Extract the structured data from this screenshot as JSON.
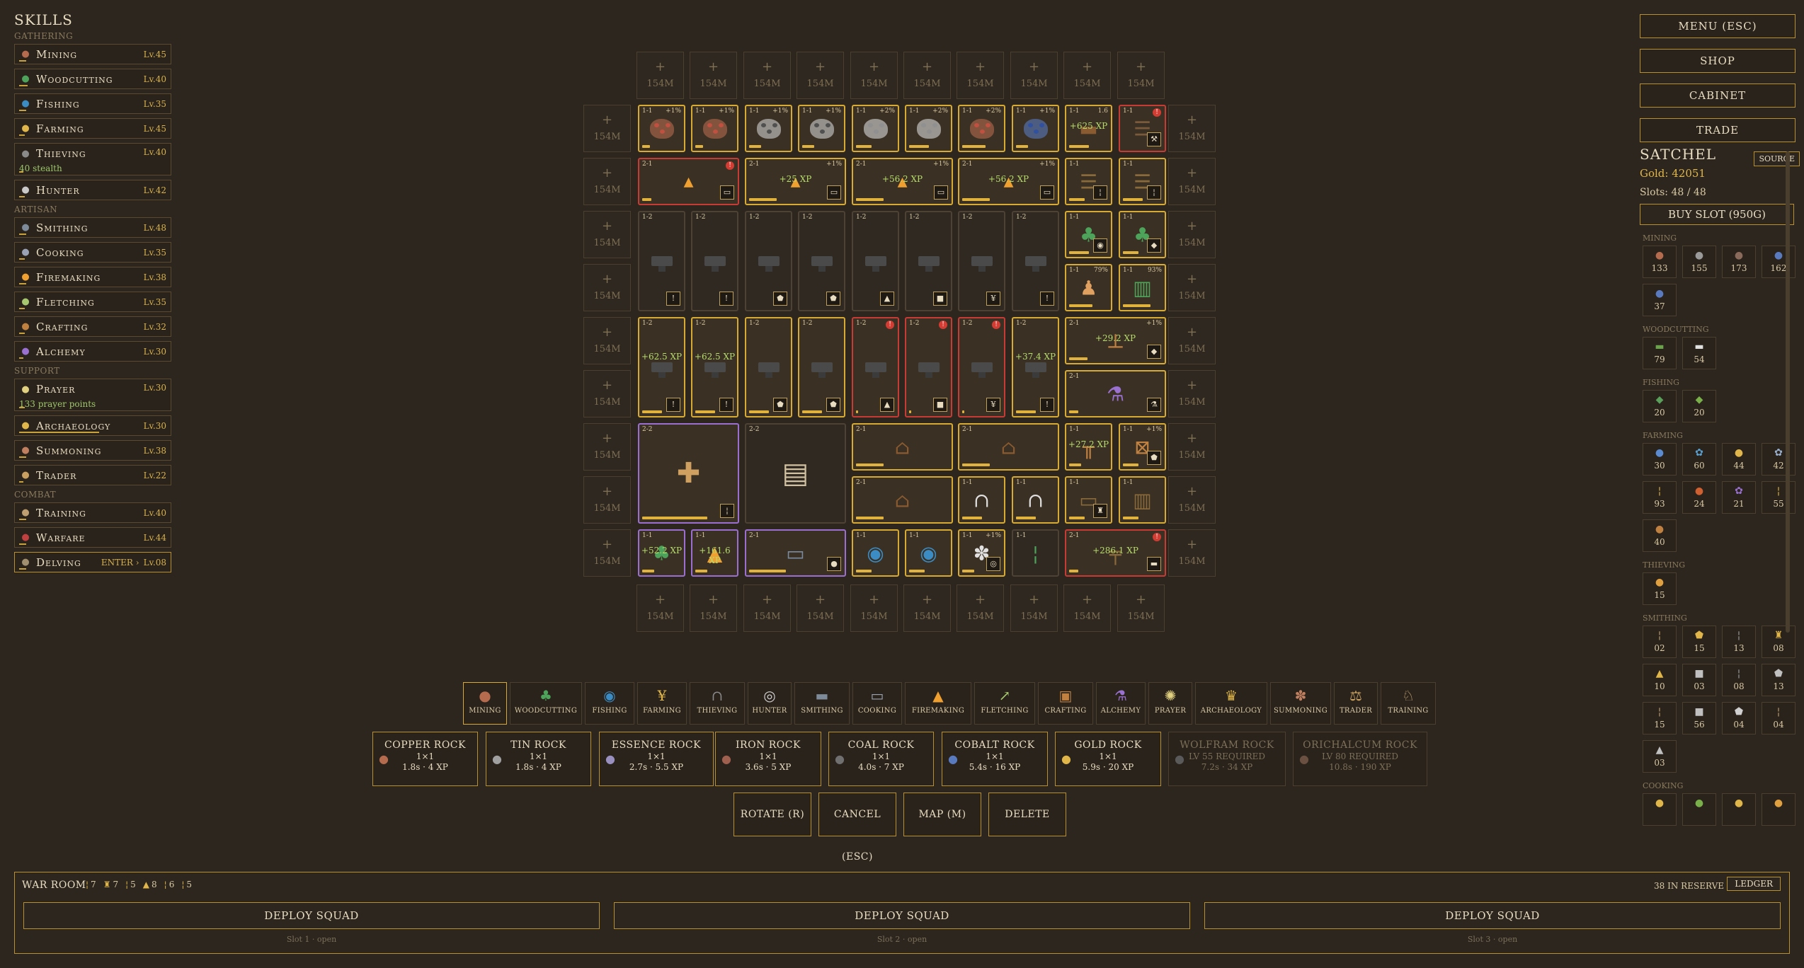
{
  "skills_panel": {
    "title": "SKILLS",
    "categories": [
      {
        "name": "GATHERING",
        "skills": [
          {
            "name": "Mining",
            "level": "Lv.45",
            "icon": "ore-icon",
            "color": "#b46b4e",
            "progress": 0.05
          },
          {
            "name": "Woodcutting",
            "level": "Lv.40",
            "icon": "tree-icon",
            "color": "#4da35a",
            "progress": 0.06
          },
          {
            "name": "Fishing",
            "level": "Lv.35",
            "icon": "fish-icon",
            "color": "#3b8cc4",
            "progress": 0.05
          },
          {
            "name": "Farming",
            "level": "Lv.45",
            "icon": "wheat-icon",
            "color": "#e0b64a",
            "progress": 0.04
          },
          {
            "name": "Thieving",
            "level": "Lv.40",
            "icon": "hood-icon",
            "color": "#8a8a8a",
            "progress": 0.03,
            "sub": "40 stealth"
          },
          {
            "name": "Hunter",
            "level": "Lv.42",
            "icon": "trap-icon",
            "color": "#c9c9c9",
            "progress": 0.04
          }
        ]
      },
      {
        "name": "ARTISAN",
        "skills": [
          {
            "name": "Smithing",
            "level": "Lv.48",
            "icon": "anvil-icon",
            "color": "#7d8a9a",
            "progress": 0.05
          },
          {
            "name": "Cooking",
            "level": "Lv.35",
            "icon": "pot-icon",
            "color": "#9aa3b5",
            "progress": 0.04
          },
          {
            "name": "Firemaking",
            "level": "Lv.38",
            "icon": "fire-icon",
            "color": "#f0a030",
            "progress": 0.05
          },
          {
            "name": "Fletching",
            "level": "Lv.35",
            "icon": "arrow-icon",
            "color": "#a8c870",
            "progress": 0.04
          },
          {
            "name": "Crafting",
            "level": "Lv.32",
            "icon": "frame-icon",
            "color": "#c08040",
            "progress": 0.04
          },
          {
            "name": "Alchemy",
            "level": "Lv.30",
            "icon": "flask-icon",
            "color": "#9a70d0",
            "progress": 0.03
          }
        ]
      },
      {
        "name": "SUPPORT",
        "skills": [
          {
            "name": "Prayer",
            "level": "Lv.30",
            "icon": "halo-icon",
            "color": "#e0d080",
            "progress": 0.04,
            "sub": "133 prayer points"
          },
          {
            "name": "Archaeology",
            "level": "Lv.30",
            "icon": "idol-icon",
            "color": "#e0b64a",
            "progress": 0.55
          },
          {
            "name": "Summoning",
            "level": "Lv.38",
            "icon": "paw-icon",
            "color": "#c08060",
            "progress": 0.05
          },
          {
            "name": "Trader",
            "level": "Lv.22",
            "icon": "scales-icon",
            "color": "#c9a060",
            "progress": 0.03
          }
        ]
      },
      {
        "name": "COMBAT",
        "skills": [
          {
            "name": "Training",
            "level": "Lv.40",
            "icon": "horn-icon",
            "color": "#c0a070",
            "progress": 0.05
          },
          {
            "name": "Warfare",
            "level": "Lv.44",
            "icon": "flag-icon",
            "color": "#c04040",
            "progress": 0.05
          },
          {
            "name": "Delving",
            "level": "Lv.08",
            "icon": "arch-icon",
            "color": "#a09070",
            "progress": 0.05,
            "enter": "ENTER ›",
            "active": true
          }
        ]
      }
    ]
  },
  "grid": {
    "expand_cost": "154M",
    "xp_popups": [
      "+62.5 XP",
      "+62.5 XP",
      "+56.2 XP",
      "+56.2 XP",
      "+37.4 XP",
      "+27.2 XP",
      "+29.2 XP",
      "+161.6 XP",
      "+286.1 XP",
      "+25 XP",
      "+625 XP",
      "+52.2 XP"
    ],
    "tile_labels": [
      "1-1",
      "2-1",
      "1-2",
      "2-2",
      "+1%",
      "+2%",
      "+1%",
      "79%",
      "93%"
    ]
  },
  "right_panel": {
    "buttons": [
      "MENU (ESC)",
      "SHOP",
      "CABINET",
      "TRADE"
    ],
    "satchel": {
      "title": "SATCHEL",
      "source_btn": "SOURCE",
      "gold": "Gold: 42051",
      "slots": "Slots: 48 / 48",
      "buy_slot": "BUY SLOT (950G)",
      "categories": [
        {
          "name": "MINING",
          "items": [
            {
              "i": "●",
              "c": "#b46b4e",
              "n": "133"
            },
            {
              "i": "●",
              "c": "#9a9a9a",
              "n": "155"
            },
            {
              "i": "●",
              "c": "#8a6a5a",
              "n": "173"
            },
            {
              "i": "●",
              "c": "#5a7ac0",
              "n": "162"
            },
            {
              "i": "●",
              "c": "#5a7ac0",
              "n": "37"
            }
          ]
        },
        {
          "name": "WOODCUTTING",
          "items": [
            {
              "i": "▬",
              "c": "#6aa34a",
              "n": "79"
            },
            {
              "i": "▬",
              "c": "#e0e0e0",
              "n": "54"
            }
          ]
        },
        {
          "name": "FISHING",
          "items": [
            {
              "i": "◆",
              "c": "#5aa05a",
              "n": "20"
            },
            {
              "i": "◆",
              "c": "#7ab04a",
              "n": "20"
            }
          ]
        },
        {
          "name": "FARMING",
          "items": [
            {
              "i": "●",
              "c": "#5a8ad0",
              "n": "30"
            },
            {
              "i": "✿",
              "c": "#5aa0d0",
              "n": "60"
            },
            {
              "i": "●",
              "c": "#e0b64a",
              "n": "44"
            },
            {
              "i": "✿",
              "c": "#9ab0d0",
              "n": "42"
            },
            {
              "i": "¦",
              "c": "#e0b64a",
              "n": "93"
            },
            {
              "i": "●",
              "c": "#d06030",
              "n": "24"
            },
            {
              "i": "✿",
              "c": "#9a70d0",
              "n": "21"
            },
            {
              "i": "¦",
              "c": "#e0b64a",
              "n": "55"
            },
            {
              "i": "●",
              "c": "#c08040",
              "n": "40"
            }
          ]
        },
        {
          "name": "THIEVING",
          "items": [
            {
              "i": "●",
              "c": "#e0a040",
              "n": "15"
            }
          ]
        },
        {
          "name": "SMITHING",
          "items": [
            {
              "i": "¦",
              "c": "#c0a070",
              "n": "02"
            },
            {
              "i": "⬟",
              "c": "#e0b64a",
              "n": "15"
            },
            {
              "i": "¦",
              "c": "#a0a0a0",
              "n": "13"
            },
            {
              "i": "♜",
              "c": "#e0b64a",
              "n": "08"
            },
            {
              "i": "▲",
              "c": "#e0b64a",
              "n": "10"
            },
            {
              "i": "■",
              "c": "#c0c0c0",
              "n": "03"
            },
            {
              "i": "¦",
              "c": "#a0a0a0",
              "n": "08"
            },
            {
              "i": "⬟",
              "c": "#c0c0c0",
              "n": "13"
            },
            {
              "i": "¦",
              "c": "#c0a070",
              "n": "15"
            },
            {
              "i": "■",
              "c": "#c0c0c0",
              "n": "56"
            },
            {
              "i": "⬟",
              "c": "#d0d0d0",
              "n": "04"
            },
            {
              "i": "¦",
              "c": "#c0a070",
              "n": "04"
            },
            {
              "i": "▲",
              "c": "#c0c0c0",
              "n": "03"
            }
          ]
        },
        {
          "name": "COOKING",
          "items": [
            {
              "i": "●",
              "c": "#e0b64a",
              "n": ""
            },
            {
              "i": "●",
              "c": "#7ab04a",
              "n": ""
            },
            {
              "i": "●",
              "c": "#e0b64a",
              "n": ""
            },
            {
              "i": "●",
              "c": "#e0a040",
              "n": ""
            }
          ]
        }
      ]
    }
  },
  "skill_tabs": [
    {
      "label": "MINING",
      "icon": "●",
      "color": "#b46b4e",
      "active": true
    },
    {
      "label": "WOODCUTTING",
      "icon": "♣",
      "color": "#4da35a"
    },
    {
      "label": "FISHING",
      "icon": "◉",
      "color": "#3b8cc4"
    },
    {
      "label": "FARMING",
      "icon": "¥",
      "color": "#e0b64a"
    },
    {
      "label": "THIEVING",
      "icon": "∩",
      "color": "#8a8a8a"
    },
    {
      "label": "HUNTER",
      "icon": "◎",
      "color": "#d0d0d0"
    },
    {
      "label": "SMITHING",
      "icon": "▬",
      "color": "#7d8a9a"
    },
    {
      "label": "COOKING",
      "icon": "▭",
      "color": "#9aa3b5"
    },
    {
      "label": "FIREMAKING",
      "icon": "▲",
      "color": "#f0a030"
    },
    {
      "label": "FLETCHING",
      "icon": "↗",
      "color": "#a8c870"
    },
    {
      "label": "CRAFTING",
      "icon": "▣",
      "color": "#c08040"
    },
    {
      "label": "ALCHEMY",
      "icon": "⚗",
      "color": "#9a70d0"
    },
    {
      "label": "PRAYER",
      "icon": "✺",
      "color": "#e0d080"
    },
    {
      "label": "ARCHAEOLOGY",
      "icon": "♛",
      "color": "#e0b64a"
    },
    {
      "label": "SUMMONING",
      "icon": "✽",
      "color": "#c08060"
    },
    {
      "label": "TRADER",
      "icon": "⚖",
      "color": "#c9a060"
    },
    {
      "label": "TRAINING",
      "icon": "♘",
      "color": "#c0a070"
    }
  ],
  "recipes": [
    {
      "name": "COPPER ROCK",
      "size": "1×1",
      "stats": "1.8s · 4 XP",
      "color": "#b46b4e"
    },
    {
      "name": "TIN ROCK",
      "size": "1×1",
      "stats": "1.8s · 4 XP",
      "color": "#a0a0a0"
    },
    {
      "name": "ESSENCE ROCK",
      "size": "1×1",
      "stats": "2.7s · 5.5 XP",
      "color": "#9a90c0"
    },
    {
      "name": "IRON ROCK",
      "size": "1×1",
      "stats": "3.6s · 5 XP",
      "color": "#a06050"
    },
    {
      "name": "COAL ROCK",
      "size": "1×1",
      "stats": "4.0s · 7 XP",
      "color": "#707070"
    },
    {
      "name": "COBALT ROCK",
      "size": "1×1",
      "stats": "5.4s · 16 XP",
      "color": "#5a7ac0"
    },
    {
      "name": "GOLD ROCK",
      "size": "1×1",
      "stats": "5.9s · 20 XP",
      "color": "#e0b64a"
    },
    {
      "name": "WOLFRAM ROCK",
      "size": "LV 55 REQUIRED",
      "stats": "7.2s · 34 XP",
      "color": "#5a5a5a",
      "locked": true
    },
    {
      "name": "ORICHALCUM ROCK",
      "size": "LV 80 REQUIRED",
      "stats": "10.8s · 190 XP",
      "color": "#6a5040",
      "locked": true
    }
  ],
  "actions": [
    "ROTATE (R)",
    "CANCEL (ESC)",
    "MAP (M)",
    "DELETE"
  ],
  "war_room": {
    "title": "WAR ROOM",
    "units": [
      "7",
      "7",
      "5",
      "8",
      "6",
      "5"
    ],
    "reserve": "38 IN RESERVE",
    "ledger": "LEDGER",
    "deploy_label": "DEPLOY SQUAD",
    "slots": [
      "Slot 1 · open",
      "Slot 2 · open",
      "Slot 3 · open"
    ]
  }
}
